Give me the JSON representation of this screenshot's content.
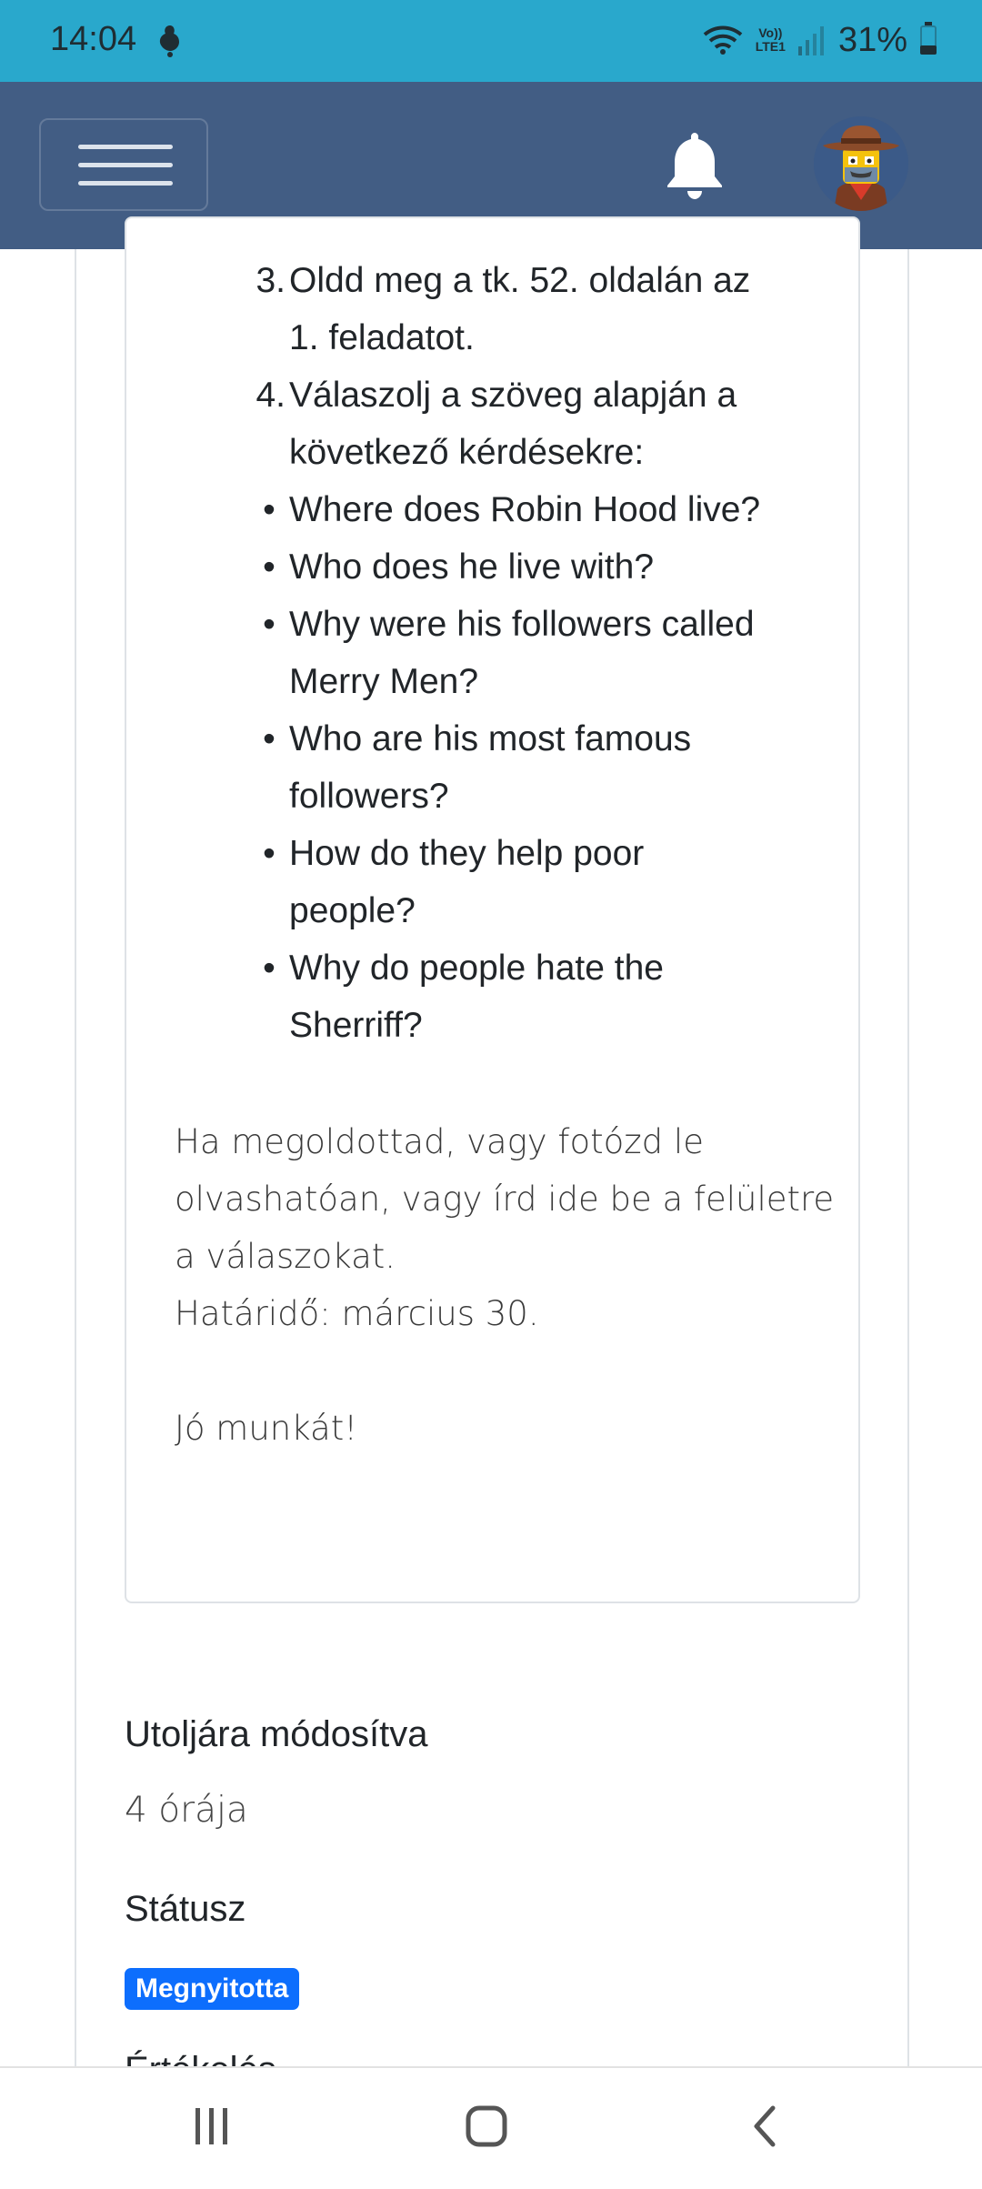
{
  "status_bar": {
    "time": "14:04",
    "network_label": "Vo))\nLTE1",
    "battery": "31%"
  },
  "header": {
    "menu_icon": "hamburger-icon",
    "notification_icon": "bell-icon",
    "avatar_icon": "cowboy-avatar"
  },
  "description": {
    "numbered_items": [
      {
        "number": "3.",
        "lines": [
          "Oldd meg a tk. 52. oldalán az",
          "1. feladatot."
        ]
      },
      {
        "number": "4.",
        "lines": [
          "Válaszolj a szöveg alapján a",
          "következő kérdésekre:"
        ]
      }
    ],
    "bullets": [
      {
        "lines": [
          "Where does Robin Hood live?"
        ]
      },
      {
        "lines": [
          "Who does he live with?"
        ]
      },
      {
        "lines": [
          "Why were his followers called",
          "Merry Men?"
        ]
      },
      {
        "lines": [
          "Who are his most famous",
          "followers?"
        ]
      },
      {
        "lines": [
          "How do they help poor",
          "people?"
        ]
      },
      {
        "lines": [
          "Why do people hate the",
          "Sherriff?"
        ]
      }
    ],
    "paragraph_lines": [
      "Ha megoldottad, vagy fotózd le",
      "olvashatóan, vagy írd ide be a felületre",
      "a válaszokat.",
      "Határidő: március 30."
    ],
    "closing": "Jó munkát!"
  },
  "meta": {
    "modified_label": "Utoljára módosítva",
    "modified_value": "4 órája",
    "status_label": "Státusz",
    "status_badge": "Megnyitotta",
    "badge_color": "#0d6efd",
    "cut_off_label": "Értékelés"
  },
  "colors": {
    "status_bar": "#29a8cc",
    "app_bar": "#425d84"
  }
}
